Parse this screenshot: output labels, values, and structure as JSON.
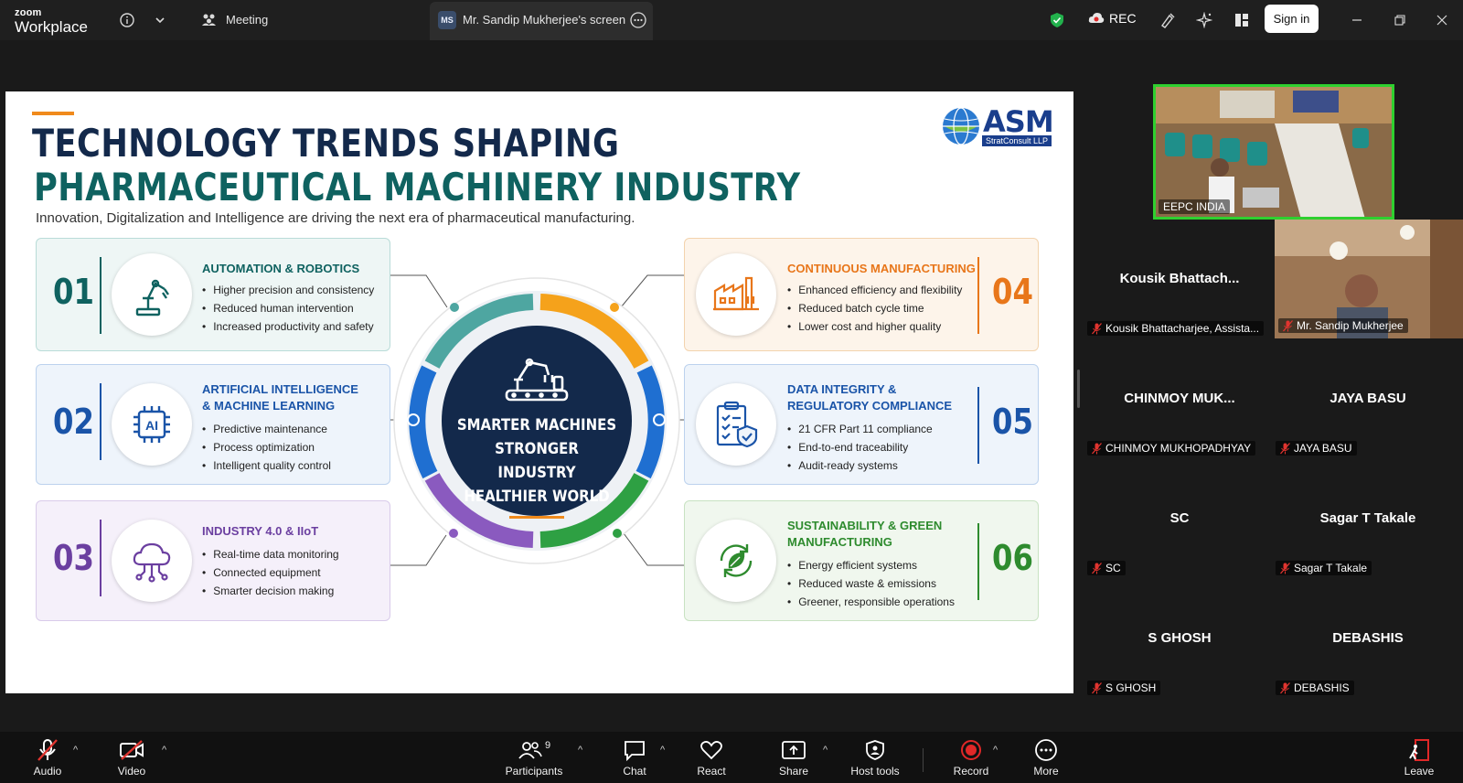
{
  "app": {
    "brand_top": "zoom",
    "brand_bottom": "Workplace"
  },
  "topbar": {
    "meeting_label": "Meeting",
    "share_initials": "MS",
    "share_tab_label": "Mr. Sandip Mukherjee's screen",
    "rec_label": "REC",
    "signin_label": "Sign in"
  },
  "slide": {
    "title_line1": "TECHNOLOGY TRENDS SHAPING",
    "title_line2": "PHARMACEUTICAL MACHINERY INDUSTRY",
    "subtitle": "Innovation, Digitalization and Intelligence are driving the next era of pharmaceutical manufacturing.",
    "logo_text": "ASM",
    "logo_sub": "StratConsult LLP",
    "center": {
      "line1": "SMARTER MACHINES",
      "line2": "STRONGER INDUSTRY",
      "line3": "HEALTHIER WORLD"
    },
    "cards": [
      {
        "num": "01",
        "title_1": "AUTOMATION & ROBOTICS",
        "title_2": "",
        "bullets": [
          "Higher precision and consistency",
          "Reduced human intervention",
          "Increased productivity and safety"
        ],
        "color": "#0f6260",
        "bg": "#eef6f5",
        "border": "#b9dcd8",
        "icon": "robot-arm-icon"
      },
      {
        "num": "02",
        "title_1": "ARTIFICIAL INTELLIGENCE",
        "title_2": "& MACHINE LEARNING",
        "bullets": [
          "Predictive maintenance",
          "Process optimization",
          "Intelligent quality control"
        ],
        "color": "#1a54a8",
        "bg": "#eef4fb",
        "border": "#bcd2ee",
        "icon": "ai-chip-icon"
      },
      {
        "num": "03",
        "title_1": "INDUSTRY 4.0 & IIoT",
        "title_2": "",
        "bullets": [
          "Real-time data monitoring",
          "Connected equipment",
          "Smarter decision making"
        ],
        "color": "#6b3fa0",
        "bg": "#f5f0fa",
        "border": "#d9cbea",
        "icon": "cloud-network-icon"
      },
      {
        "num": "04",
        "title_1": "CONTINUOUS MANUFACTURING",
        "title_2": "",
        "bullets": [
          "Enhanced efficiency and flexibility",
          "Reduced batch cycle time",
          "Lower cost and higher quality"
        ],
        "color": "#e8761a",
        "bg": "#fdf4ea",
        "border": "#f3d3ad",
        "icon": "factory-icon"
      },
      {
        "num": "05",
        "title_1": "DATA INTEGRITY &",
        "title_2": "REGULATORY COMPLIANCE",
        "bullets": [
          "21 CFR Part 11 compliance",
          "End-to-end traceability",
          "Audit-ready systems"
        ],
        "color": "#1a54a8",
        "bg": "#eef4fb",
        "border": "#bcd2ee",
        "icon": "compliance-checklist-icon"
      },
      {
        "num": "06",
        "title_1": "SUSTAINABILITY & GREEN",
        "title_2": "MANUFACTURING",
        "bullets": [
          "Energy efficient systems",
          "Reduced waste & emissions",
          "Greener, responsible operations"
        ],
        "color": "#2e8b2e",
        "bg": "#f0f7ee",
        "border": "#c8e2c2",
        "icon": "recycle-leaf-icon"
      }
    ]
  },
  "participants": {
    "videos": [
      {
        "label": "EEPC INDIA"
      },
      {
        "label": "Mr. Sandip Mukherjee"
      }
    ],
    "tiles": [
      {
        "display": "Kousik  Bhattach...",
        "plate": "Kousik Bhattacharjee, Assista..."
      },
      {
        "display": "CHINMOY  MUK...",
        "plate": "CHINMOY MUKHOPADHYAY"
      },
      {
        "display": "JAYA BASU",
        "plate": "JAYA BASU"
      },
      {
        "display": "SC",
        "plate": "SC"
      },
      {
        "display": "Sagar T Takale",
        "plate": "Sagar T Takale"
      },
      {
        "display": "S GHOSH",
        "plate": "S GHOSH"
      },
      {
        "display": "DEBASHIS",
        "plate": "DEBASHIS"
      }
    ]
  },
  "toolbar": {
    "audio": "Audio",
    "video": "Video",
    "participants": "Participants",
    "participants_count": "9",
    "chat": "Chat",
    "react": "React",
    "share": "Share",
    "host_tools": "Host tools",
    "record": "Record",
    "more": "More",
    "leave": "Leave"
  },
  "colors": {
    "brand_navy": "#13294b",
    "brand_teal": "#0f6260",
    "orange": "#f08a1c",
    "record_red": "#e02828",
    "mute_red": "#e0342f",
    "active_speaker": "#2fd02f"
  }
}
